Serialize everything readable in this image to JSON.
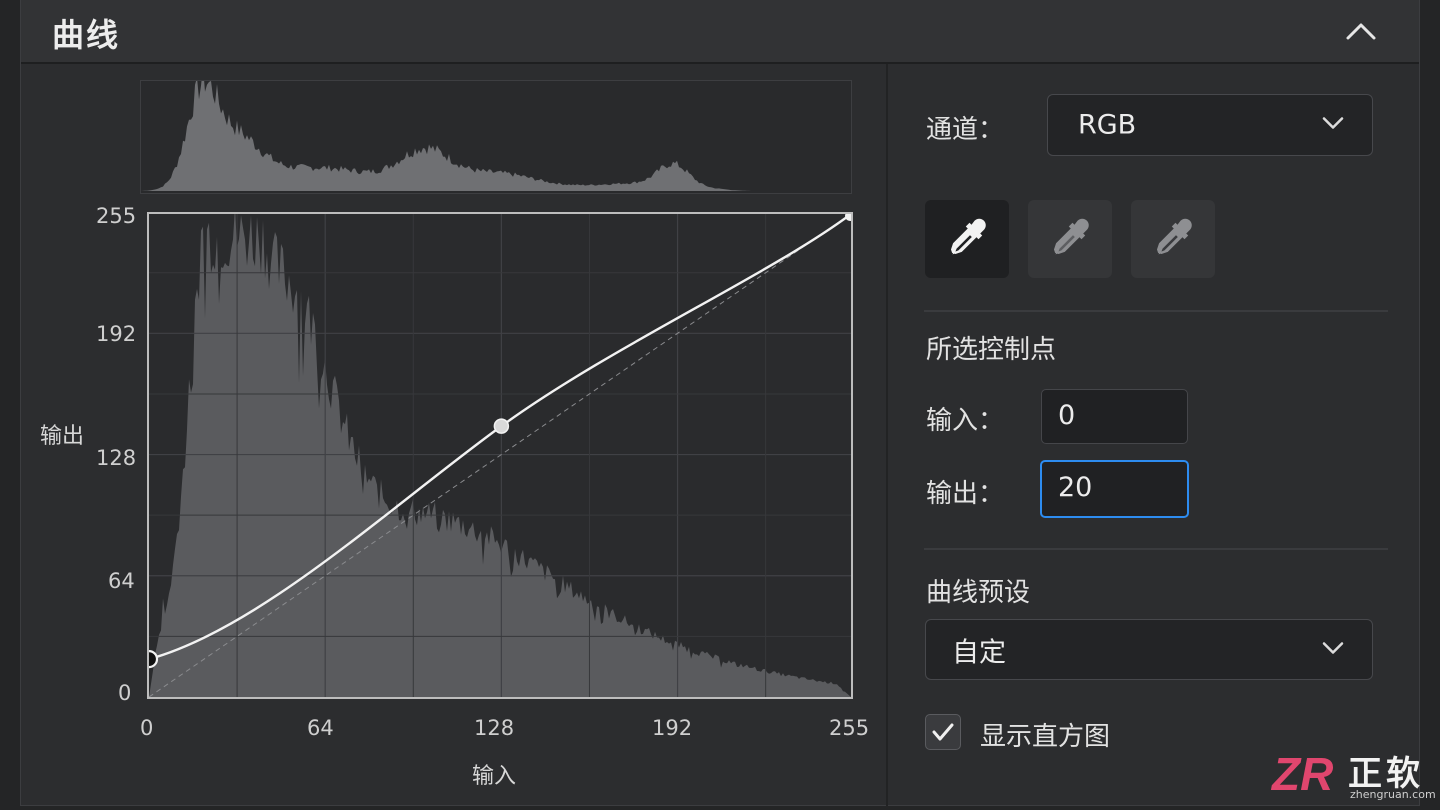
{
  "header": {
    "title": "曲线"
  },
  "graph": {
    "y_ticks": [
      "255",
      "192",
      "128",
      "64",
      "0"
    ],
    "x_ticks": [
      "0",
      "64",
      "128",
      "192",
      "255"
    ],
    "ylabel": "输出",
    "xlabel": "输入",
    "control_points": [
      {
        "input": 0,
        "output": 20
      },
      {
        "input": 128,
        "output": 143
      },
      {
        "input": 255,
        "output": 255
      }
    ]
  },
  "channel": {
    "label": "通道：",
    "value": "RGB"
  },
  "eyedroppers": [
    "black-point-eyedropper",
    "gray-point-eyedropper",
    "white-point-eyedropper"
  ],
  "selected_point": {
    "heading": "所选控制点",
    "input_label": "输入：",
    "input_value": "0",
    "output_label": "输出：",
    "output_value": "20"
  },
  "preset": {
    "label": "曲线预设",
    "value": "自定"
  },
  "show_histogram": {
    "label": "显示直方图",
    "checked": true
  },
  "watermark": {
    "text": "正软",
    "sub": "zhengruan.com",
    "mark": "ZR"
  },
  "colors": {
    "accent": "#2d8cf0",
    "logo": "#e0466e"
  }
}
